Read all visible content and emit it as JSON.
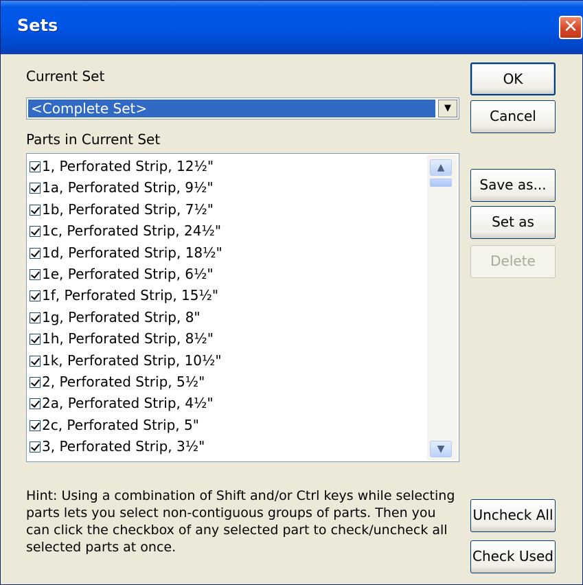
{
  "window": {
    "title": "Sets",
    "close_glyph": "✕"
  },
  "current_set": {
    "label": "Current Set",
    "value": "<Complete Set>",
    "dropdown_glyph": "▼"
  },
  "parts": {
    "label": "Parts in Current Set",
    "items": [
      {
        "text": "1, Perforated Strip, 12½\"",
        "checked": true
      },
      {
        "text": "1a, Perforated Strip, 9½\"",
        "checked": true
      },
      {
        "text": "1b, Perforated Strip, 7½\"",
        "checked": true
      },
      {
        "text": "1c, Perforated Strip, 24½\"",
        "checked": true
      },
      {
        "text": "1d, Perforated Strip, 18½\"",
        "checked": true
      },
      {
        "text": "1e, Perforated Strip, 6½\"",
        "checked": true
      },
      {
        "text": "1f, Perforated Strip, 15½\"",
        "checked": true
      },
      {
        "text": "1g, Perforated Strip, 8\"",
        "checked": true
      },
      {
        "text": "1h, Perforated Strip, 8½\"",
        "checked": true
      },
      {
        "text": "1k, Perforated Strip, 10½\"",
        "checked": true
      },
      {
        "text": "2, Perforated Strip, 5½\"",
        "checked": true
      },
      {
        "text": "2a, Perforated Strip, 4½\"",
        "checked": true
      },
      {
        "text": "2c, Perforated Strip, 5\"",
        "checked": true
      },
      {
        "text": "3, Perforated Strip, 3½\"",
        "checked": true
      }
    ],
    "scroll_up_glyph": "▲",
    "scroll_down_glyph": "▼"
  },
  "buttons": {
    "ok": "OK",
    "cancel": "Cancel",
    "save_as": "Save as...",
    "set_default": "Set as Default",
    "delete": "Delete",
    "uncheck_all": "Uncheck All",
    "check_used": "Check Used"
  },
  "hint": "Hint: Using a combination of Shift and/or Ctrl keys while selecting parts lets you select non-contiguous groups of parts. Then you can click the checkbox of any selected part to check/uncheck all selected parts at once."
}
